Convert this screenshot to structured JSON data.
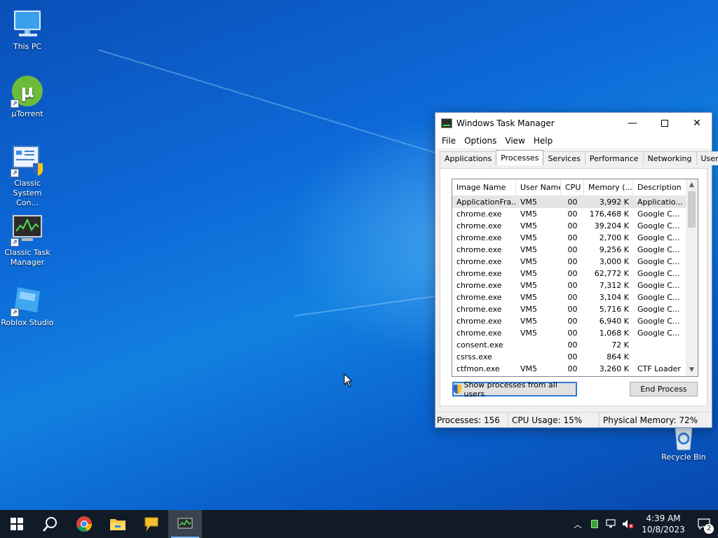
{
  "desktop": {
    "icons": [
      {
        "label": "This PC"
      },
      {
        "label": "µTorrent"
      },
      {
        "label": "Classic System Con..."
      },
      {
        "label": "Classic Task Manager"
      },
      {
        "label": "Roblox Studio"
      },
      {
        "label": "Recycle Bin"
      }
    ]
  },
  "taskmanager": {
    "title": "Windows Task Manager",
    "menu": [
      "File",
      "Options",
      "View",
      "Help"
    ],
    "tabs": [
      "Applications",
      "Processes",
      "Services",
      "Performance",
      "Networking",
      "Users"
    ],
    "active_tab": "Processes",
    "columns": [
      "Image Name",
      "User Name",
      "CPU",
      "Memory (...",
      "Description"
    ],
    "rows": [
      {
        "name": "ApplicationFra...",
        "user": "VM5",
        "cpu": "00",
        "mem": "3,992 K",
        "desc": "Applicatio..."
      },
      {
        "name": "chrome.exe",
        "user": "VM5",
        "cpu": "00",
        "mem": "176,468 K",
        "desc": "Google C..."
      },
      {
        "name": "chrome.exe",
        "user": "VM5",
        "cpu": "00",
        "mem": "39,204 K",
        "desc": "Google C..."
      },
      {
        "name": "chrome.exe",
        "user": "VM5",
        "cpu": "00",
        "mem": "2,700 K",
        "desc": "Google C..."
      },
      {
        "name": "chrome.exe",
        "user": "VM5",
        "cpu": "00",
        "mem": "9,256 K",
        "desc": "Google C..."
      },
      {
        "name": "chrome.exe",
        "user": "VM5",
        "cpu": "00",
        "mem": "3,000 K",
        "desc": "Google C..."
      },
      {
        "name": "chrome.exe",
        "user": "VM5",
        "cpu": "00",
        "mem": "62,772 K",
        "desc": "Google C..."
      },
      {
        "name": "chrome.exe",
        "user": "VM5",
        "cpu": "00",
        "mem": "7,312 K",
        "desc": "Google C..."
      },
      {
        "name": "chrome.exe",
        "user": "VM5",
        "cpu": "00",
        "mem": "3,104 K",
        "desc": "Google C..."
      },
      {
        "name": "chrome.exe",
        "user": "VM5",
        "cpu": "00",
        "mem": "5,716 K",
        "desc": "Google C..."
      },
      {
        "name": "chrome.exe",
        "user": "VM5",
        "cpu": "00",
        "mem": "6,940 K",
        "desc": "Google C..."
      },
      {
        "name": "chrome.exe",
        "user": "VM5",
        "cpu": "00",
        "mem": "1,068 K",
        "desc": "Google C..."
      },
      {
        "name": "consent.exe",
        "user": "",
        "cpu": "00",
        "mem": "72 K",
        "desc": ""
      },
      {
        "name": "csrss.exe",
        "user": "",
        "cpu": "00",
        "mem": "864 K",
        "desc": ""
      },
      {
        "name": "ctfmon.exe",
        "user": "VM5",
        "cpu": "00",
        "mem": "3,260 K",
        "desc": "CTF Loader"
      }
    ],
    "show_all_label": "Show processes from all users",
    "end_process_label": "End Process",
    "status": {
      "processes": "Processes: 156",
      "cpu": "CPU Usage: 15%",
      "memory": "Physical Memory: 72%"
    }
  },
  "taskbar": {
    "clock_time": "4:39 AM",
    "clock_date": "10/8/2023",
    "notification_count": "2"
  },
  "colors": {
    "taskbar": "#111a27",
    "selection": "#e5e5e5",
    "accent": "#2d7ad4"
  }
}
